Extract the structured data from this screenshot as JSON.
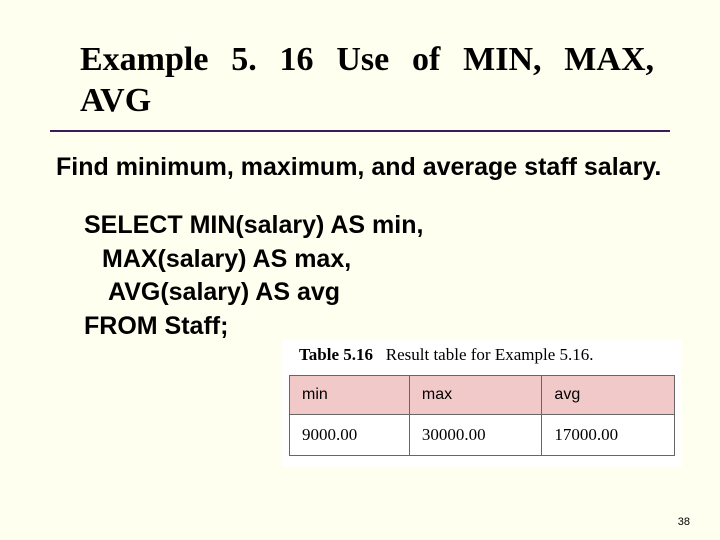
{
  "title_line1": "Example 5. 16  Use of MIN, MAX,",
  "title_line2": "AVG",
  "problem_text": "Find minimum, maximum, and average staff salary.",
  "sql": {
    "line1": "SELECT MIN(salary) AS min,",
    "line2": "MAX(salary) AS max,",
    "line3": "AVG(salary) AS avg",
    "line4": "FROM Staff;"
  },
  "table_caption_bold": "Table 5.16",
  "table_caption_rest": "Result table for Example 5.16.",
  "chart_data": {
    "type": "table",
    "columns": [
      "min",
      "max",
      "avg"
    ],
    "rows": [
      [
        "9000.00",
        "30000.00",
        "17000.00"
      ]
    ]
  },
  "page_number": "38"
}
